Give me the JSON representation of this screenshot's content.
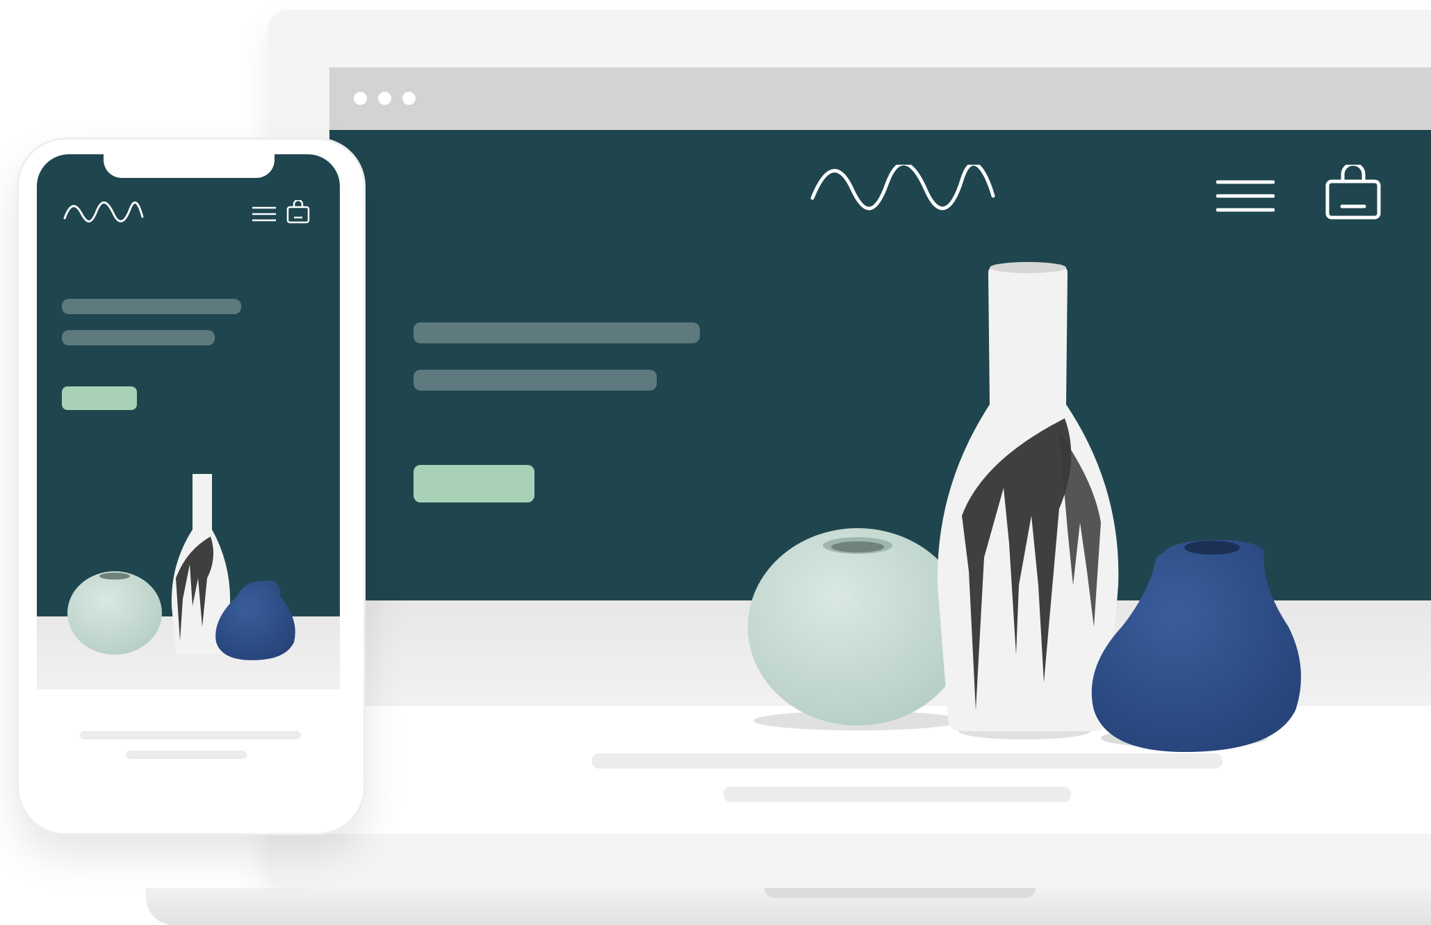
{
  "colors": {
    "hero_background": "#1f464e",
    "placeholder_bar": "#5f7a7e",
    "cta_button": "#a9d1b6",
    "browser_chrome": "#d3d3d3",
    "vase_mint": "#c9ddd6",
    "vase_navy": "#304f88"
  },
  "icons": {
    "logo": "wave-logo-icon",
    "menu": "hamburger-menu-icon",
    "cart": "shopping-bag-icon"
  }
}
